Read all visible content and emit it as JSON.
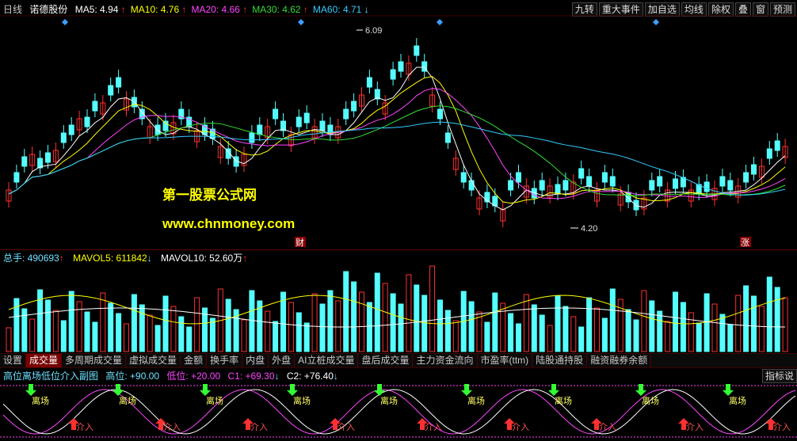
{
  "header": {
    "period": "日线",
    "stock_name": "诺德股份",
    "ma": [
      {
        "label": "MA5: 4.94",
        "arrow": "↑",
        "color": "#ffffff",
        "dir": "up"
      },
      {
        "label": "MA10: 4.76",
        "arrow": "↑",
        "color": "#ffff00",
        "dir": "up"
      },
      {
        "label": "MA20: 4.66",
        "arrow": "↑",
        "color": "#ff44ff",
        "dir": "up"
      },
      {
        "label": "MA30: 4.62",
        "arrow": "↑",
        "color": "#33dd33",
        "dir": "up"
      },
      {
        "label": "MA60: 4.71",
        "arrow": "↓",
        "color": "#33ccff",
        "dir": "down"
      }
    ]
  },
  "toolbar": [
    "九转",
    "重大事件",
    "加自选",
    "均线",
    "除权",
    "叠",
    "窗",
    "预测"
  ],
  "price_chart": {
    "high_label": "6.09",
    "low_label": "4.20",
    "event_labels": [
      "财",
      "涨"
    ],
    "watermark_title": "第一股票公式网",
    "watermark_url": "www.chnmoney.com"
  },
  "volume": {
    "total_label": "总手: 490693",
    "total_arrow": "↑",
    "mavol5_label": "MAVOL5: 611842",
    "mavol5_arrow": "↓",
    "mavol10_label": "MAVOL10: 52.60万",
    "mavol10_arrow": "↑"
  },
  "tabs": [
    "设置",
    "成交量",
    "多周期成交量",
    "虚拟成交量",
    "金额",
    "换手率",
    "内盘",
    "外盘",
    "AI立桩成交量",
    "盘后成交量",
    "主力资金流向",
    "市盈率(ttm)",
    "陆股通持股",
    "融资融券余额"
  ],
  "active_tab": "成交量",
  "indicator": {
    "name": "高位离场低位介入副图",
    "high_label": "高位: +90.00",
    "low_label": "低位: +20.00",
    "c1_label": "C1: +69.30",
    "c1_arrow": "↓",
    "c2_label": "C2: +76.40",
    "c2_arrow": "↓",
    "exit_label": "离场",
    "entry_label": "介入",
    "button": "指标说"
  },
  "colors": {
    "up": "#ff3030",
    "down": "#55ffff",
    "ma5": "#ffffff",
    "ma10": "#ffff00",
    "ma20": "#ff44ff",
    "ma30": "#33dd33",
    "ma60": "#33ccff"
  }
}
